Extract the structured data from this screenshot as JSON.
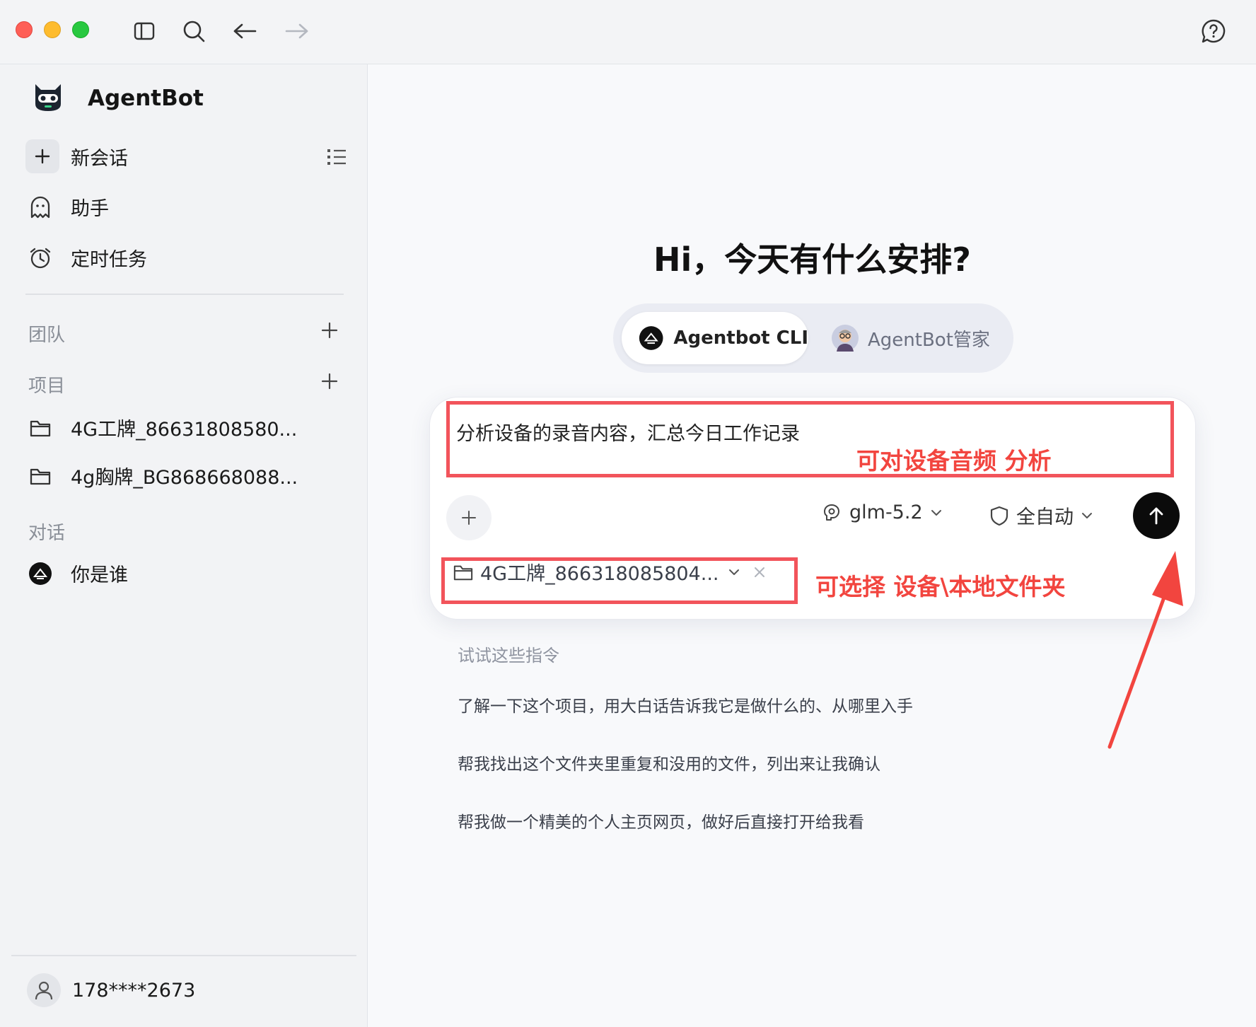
{
  "app": {
    "name": "AgentBot"
  },
  "sidebar": {
    "new_chat": "新会话",
    "nav": [
      {
        "label": "助手",
        "icon": "ghost-icon"
      },
      {
        "label": "定时任务",
        "icon": "alarm-clock-icon"
      }
    ],
    "sections": {
      "team": "团队",
      "projects": "项目",
      "conversations": "对话"
    },
    "projects": [
      {
        "label": "4G工牌_86631808580..."
      },
      {
        "label": "4g胸牌_BG868668088..."
      }
    ],
    "conversations": [
      {
        "label": "你是谁"
      }
    ],
    "user": {
      "phone": "178****2673"
    }
  },
  "main": {
    "greeting": "Hi，今天有什么安排?",
    "agents": [
      {
        "label": "Agentbot CLI",
        "active": true
      },
      {
        "label": "AgentBot管家",
        "active": false
      }
    ],
    "composer": {
      "text": "分析设备的录音内容，汇总今日工作记录",
      "model": "glm-5.2",
      "mode": "全自动"
    },
    "folder": {
      "label": "4G工牌_866318085804..."
    },
    "annotations": {
      "audio": "可对设备音频 分析",
      "folder": "可选择  设备\\本地文件夹"
    },
    "suggestions_title": "试试这些指令",
    "suggestions": [
      "了解一下这个项目，用大白话告诉我它是做什么的、从哪里入手",
      "帮我找出这个文件夹里重复和没用的文件，列出来让我确认",
      "帮我做一个精美的个人主页网页，做好后直接打开给我看"
    ]
  },
  "colors": {
    "annotation": "#f2453f",
    "send": "#0b0b0b"
  }
}
